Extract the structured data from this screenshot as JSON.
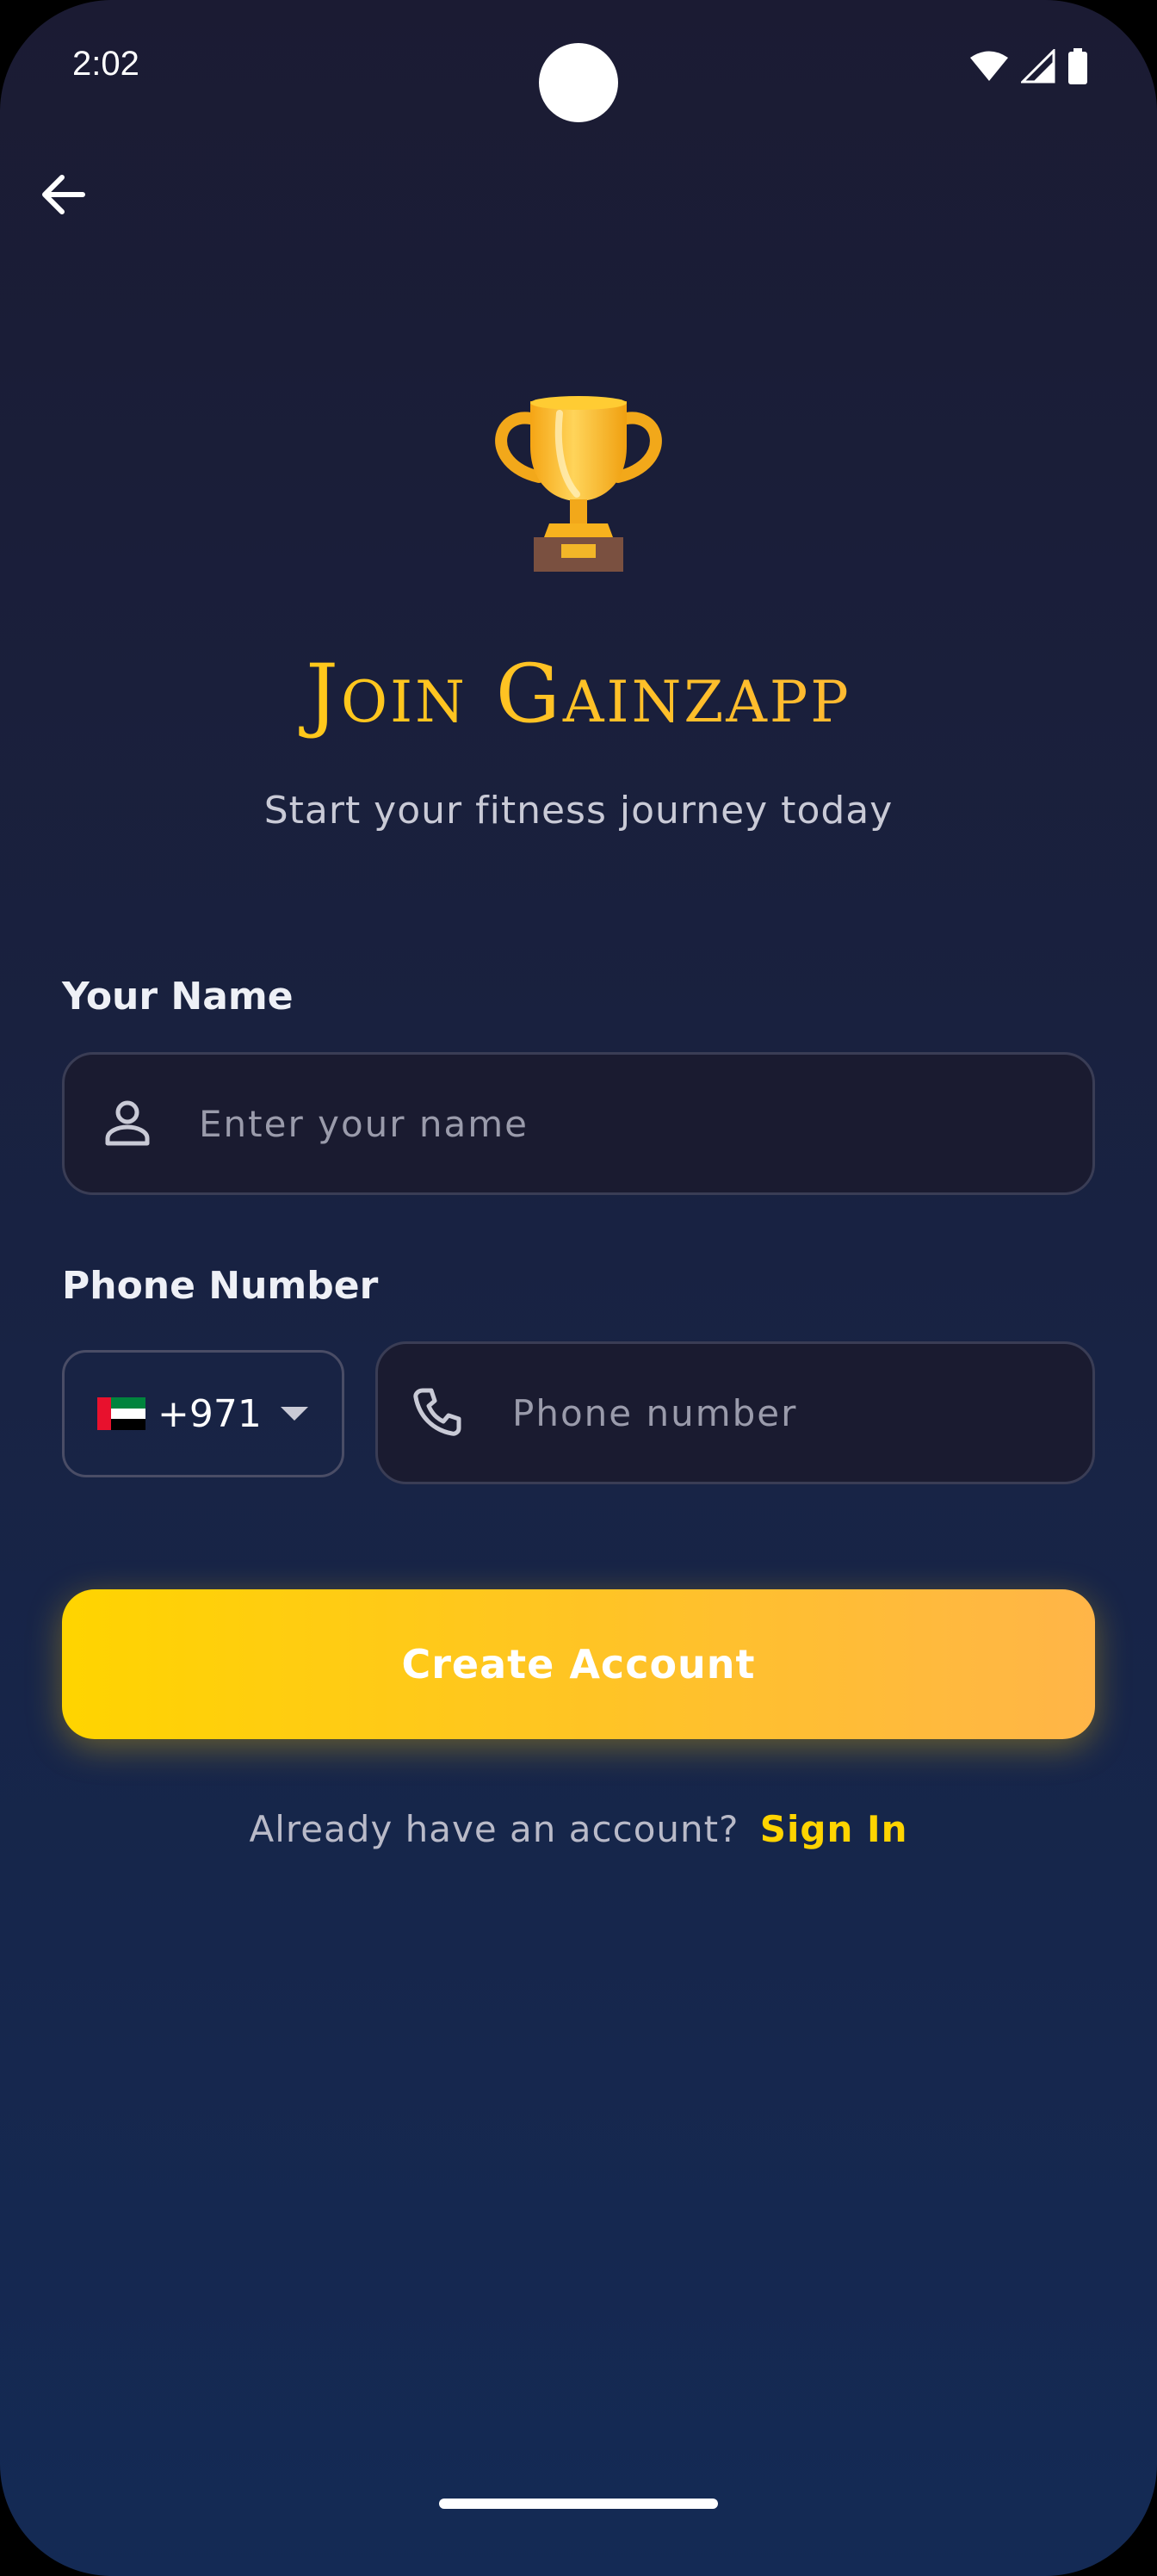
{
  "status_bar": {
    "time": "2:02",
    "icons": [
      "wifi-icon",
      "signal-icon",
      "battery-icon"
    ]
  },
  "nav": {
    "back_icon": "arrow-left-icon"
  },
  "hero": {
    "icon": "trophy-icon",
    "title": "Join Gainzapp",
    "subtitle": "Start your fitness journey today"
  },
  "form": {
    "name": {
      "label": "Your Name",
      "placeholder": "Enter your name",
      "value": "",
      "icon": "person-icon"
    },
    "phone": {
      "label": "Phone Number",
      "country_flag": "🇦🇪",
      "country_code": "+971",
      "placeholder": "Phone number",
      "value": "",
      "icon": "phone-icon"
    },
    "submit_label": "Create Account"
  },
  "footer": {
    "prompt": "Already have an account?",
    "link": "Sign In"
  },
  "colors": {
    "accent_start": "#ffd400",
    "accent_end": "#ffb548",
    "background_top": "#1b1b33",
    "background_bottom": "#142a55"
  }
}
